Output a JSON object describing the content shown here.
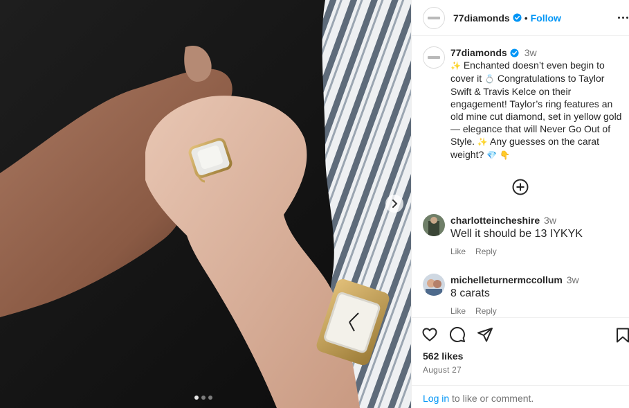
{
  "post": {
    "username": "77diamonds",
    "follow_label": "Follow",
    "separator": "•",
    "caption": {
      "time": "3w",
      "text_parts": [
        " Enchanted doesn’t even begin to cover it ",
        " Congratulations to Taylor Swift & Travis Kelce on their engagement! Taylor’s ring features an old mine cut diamond, set in yellow gold — elegance that will Never Go Out of Style. ",
        " Any guesses on the carat weight? "
      ],
      "emoji": {
        "sparkles": "✨",
        "ring": "💍",
        "gem": "💎",
        "point_down": "👇"
      }
    },
    "comments": [
      {
        "username": "charlotteincheshire",
        "time": "3w",
        "text": "Well it should be 13 IYKYK",
        "like_label": "Like",
        "reply_label": "Reply"
      },
      {
        "username": "michelleturnermccollum",
        "time": "3w",
        "text": "8 carats",
        "like_label": "Like",
        "reply_label": "Reply"
      }
    ],
    "likes": "562 likes",
    "date": "August 27",
    "login_link": "Log in",
    "login_suffix": " to like or comment."
  },
  "carousel": {
    "dots": 3,
    "active_index": 0
  },
  "icons": {
    "verified": "verified-badge-icon",
    "more": "more-options-icon",
    "next": "chevron-right-icon",
    "load_more": "plus-circle-icon",
    "like": "heart-icon",
    "comment": "comment-bubble-icon",
    "share": "paper-plane-icon",
    "save": "bookmark-icon"
  },
  "colors": {
    "link_blue": "#0095f6",
    "text_primary": "#262626",
    "text_secondary": "#737373",
    "divider": "#efefef"
  }
}
